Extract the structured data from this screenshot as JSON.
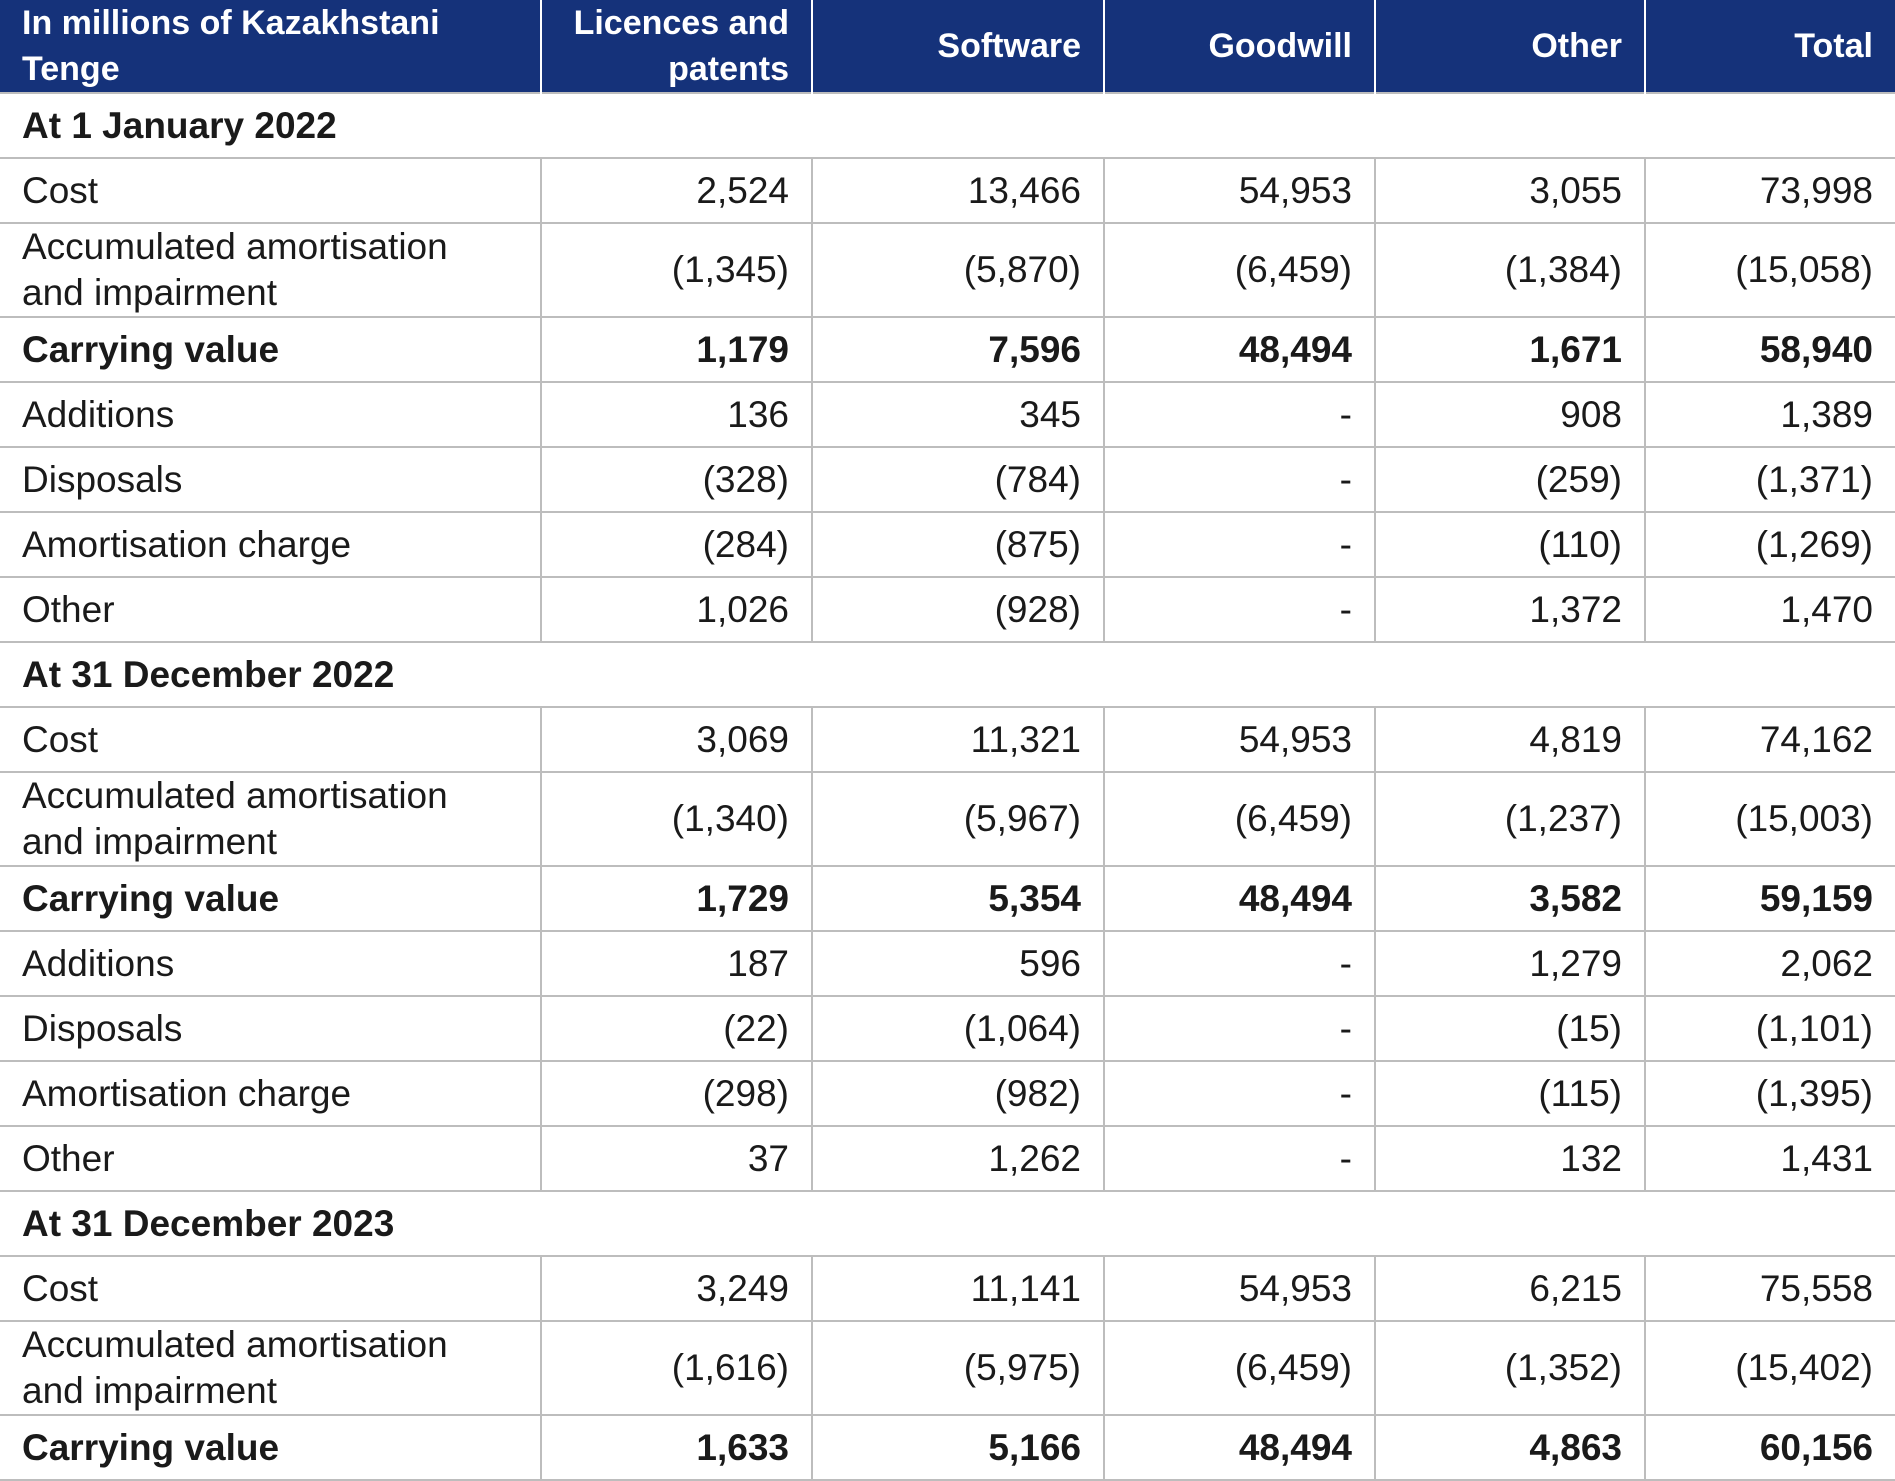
{
  "table": {
    "headers": [
      "In millions of Kazakhstani Tenge",
      "Licences and patents",
      "Software",
      "Goodwill",
      "Other",
      "Total"
    ],
    "sections": [
      {
        "title": "At 1 January 2022",
        "rows": [
          {
            "label": "Cost",
            "values": [
              "2,524",
              "13,466",
              "54,953",
              "3,055",
              "73,998"
            ]
          },
          {
            "label": "Accumulated amortisation and impairment",
            "values": [
              "(1,345)",
              "(5,870)",
              "(6,459)",
              "(1,384)",
              "(15,058)"
            ]
          },
          {
            "label": "Carrying value",
            "values": [
              "1,179",
              "7,596",
              "48,494",
              "1,671",
              "58,940"
            ]
          },
          {
            "label": "Additions",
            "values": [
              "136",
              "345",
              "-",
              "908",
              "1,389"
            ]
          },
          {
            "label": "Disposals",
            "values": [
              "(328)",
              "(784)",
              "-",
              "(259)",
              "(1,371)"
            ]
          },
          {
            "label": "Amortisation charge",
            "values": [
              "(284)",
              "(875)",
              "-",
              "(110)",
              "(1,269)"
            ]
          },
          {
            "label": "Other",
            "values": [
              "1,026",
              "(928)",
              "-",
              "1,372",
              "1,470"
            ]
          }
        ]
      },
      {
        "title": "At 31 December 2022",
        "rows": [
          {
            "label": "Cost",
            "values": [
              "3,069",
              "11,321",
              "54,953",
              "4,819",
              "74,162"
            ]
          },
          {
            "label": "Accumulated amortisation and impairment",
            "values": [
              "(1,340)",
              "(5,967)",
              "(6,459)",
              "(1,237)",
              "(15,003)"
            ]
          },
          {
            "label": "Carrying value",
            "values": [
              "1,729",
              "5,354",
              "48,494",
              "3,582",
              "59,159"
            ]
          },
          {
            "label": "Additions",
            "values": [
              "187",
              "596",
              "-",
              "1,279",
              "2,062"
            ]
          },
          {
            "label": "Disposals",
            "values": [
              "(22)",
              "(1,064)",
              "-",
              "(15)",
              "(1,101)"
            ]
          },
          {
            "label": "Amortisation charge",
            "values": [
              "(298)",
              "(982)",
              "-",
              "(115)",
              "(1,395)"
            ]
          },
          {
            "label": "Other",
            "values": [
              "37",
              "1,262",
              "-",
              "132",
              "1,431"
            ]
          }
        ]
      },
      {
        "title": "At 31 December 2023",
        "rows": [
          {
            "label": "Cost",
            "values": [
              "3,249",
              "11,141",
              "54,953",
              "6,215",
              "75,558"
            ]
          },
          {
            "label": "Accumulated amortisation and impairment",
            "values": [
              "(1,616)",
              "(5,975)",
              "(6,459)",
              "(1,352)",
              "(15,402)"
            ]
          },
          {
            "label": "Carrying value",
            "values": [
              "1,633",
              "5,166",
              "48,494",
              "4,863",
              "60,156"
            ]
          }
        ]
      }
    ]
  },
  "colors": {
    "header_background": "#15327a",
    "header_text": "#ffffff",
    "grid_line": "#bdbdbd"
  }
}
